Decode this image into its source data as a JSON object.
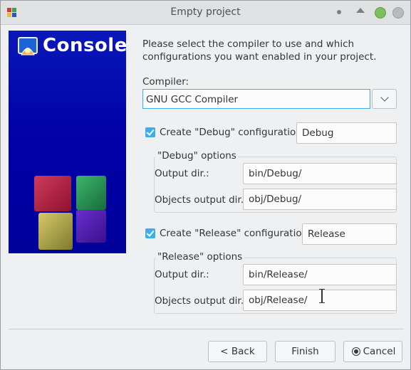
{
  "window": {
    "title": "Empty project"
  },
  "banner": {
    "title": "Console"
  },
  "intro": "Please select the compiler to use and which configurations you want enabled in your project.",
  "compiler": {
    "label": "Compiler:",
    "value": "GNU GCC Compiler"
  },
  "debug": {
    "checkbox_label": "Create \"Debug\" configuration:",
    "checked": true,
    "name_value": "Debug",
    "group_title": "\"Debug\" options",
    "output_label": "Output dir.:",
    "output_value": "bin/Debug/",
    "objects_label": "Objects output dir.:",
    "objects_value": "obj/Debug/"
  },
  "release": {
    "checkbox_label": "Create \"Release\" configuration:",
    "checked": true,
    "name_value": "Release",
    "group_title": "\"Release\" options",
    "output_label": "Output dir.:",
    "output_value": "bin/Release/",
    "objects_label": "Objects output dir.:",
    "objects_value": "obj/Release/"
  },
  "buttons": {
    "back": "< Back",
    "finish": "Finish",
    "cancel": "Cancel"
  },
  "colors": {
    "accent": "#3daee9",
    "banner": "#0000a6"
  }
}
